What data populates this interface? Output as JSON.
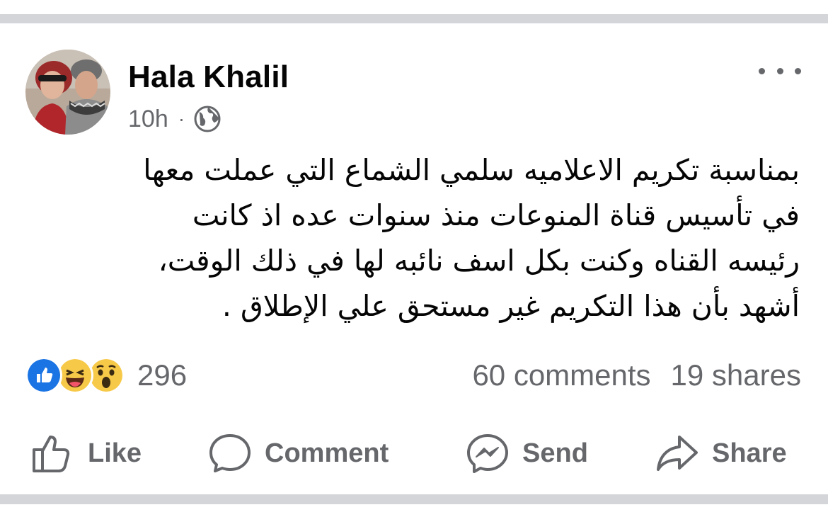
{
  "post": {
    "author": "Hala Khalil",
    "time": "10h",
    "separator": "·",
    "audience_icon": "globe-icon",
    "more_icon": "more-horizontal-icon",
    "text": "بمناسبة تكريم الاعلاميه سلمي الشماع التي عملت معها\nفي تأسيس قناة المنوعات  منذ سنوات عده اذ كانت\nرئيسه القناه وكنت بكل اسف نائبه لها في ذلك الوقت،\nأشهد بأن هذا التكريم غير مستحق علي الإطلاق  ."
  },
  "reactions": {
    "icons": [
      "like-reaction-icon",
      "haha-reaction-icon",
      "wow-reaction-icon"
    ],
    "count": "296",
    "comments": "60 comments",
    "shares": "19 shares"
  },
  "actions": {
    "like": "Like",
    "comment": "Comment",
    "send": "Send",
    "share": "Share"
  },
  "colors": {
    "text_primary": "#050505",
    "text_secondary": "#65676b",
    "like_blue": "#1b74e4",
    "reaction_yellow": "#f7c948",
    "divider": "#d3d5d9"
  }
}
